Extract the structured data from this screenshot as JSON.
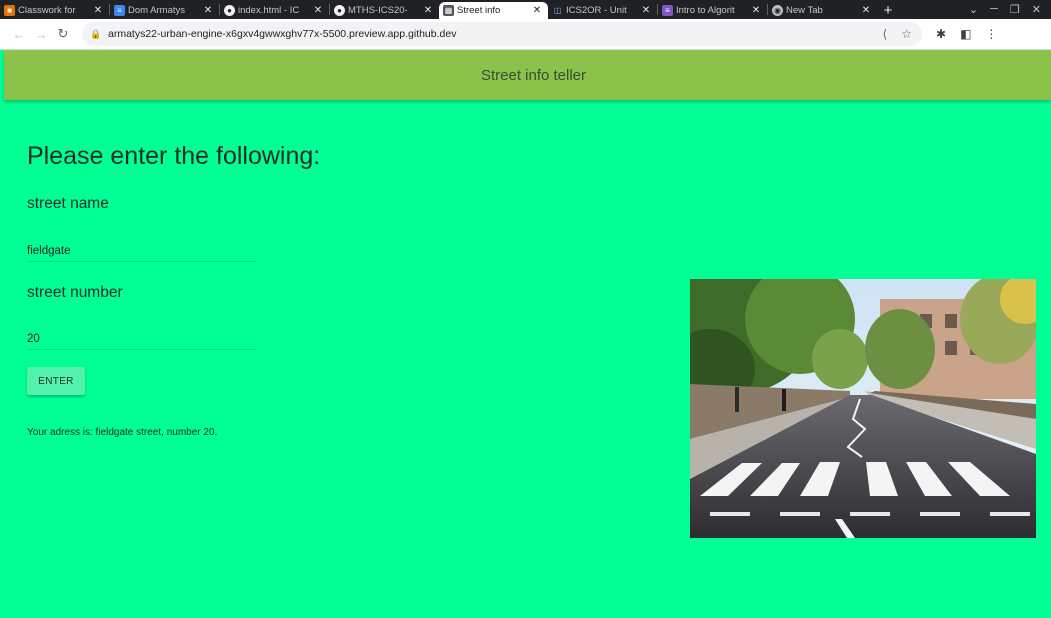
{
  "browser": {
    "tabs": [
      {
        "title": "Classwork for",
        "icon": "classroom-icon",
        "color": "#e37400"
      },
      {
        "title": "Dom Armatys",
        "icon": "docs-icon",
        "color": "#4285f4"
      },
      {
        "title": "index.html - IC",
        "icon": "github-icon",
        "color": "#f0f0f0"
      },
      {
        "title": "MTHS-ICS20-",
        "icon": "github-icon",
        "color": "#f0f0f0"
      },
      {
        "title": "Street info",
        "icon": "page-icon",
        "color": "#555555"
      },
      {
        "title": "ICS2OR - Unit",
        "icon": "trash-icon",
        "color": "#8ab4f8"
      },
      {
        "title": "Intro to Algorit",
        "icon": "list-icon",
        "color": "#7e57c2"
      },
      {
        "title": "New Tab",
        "icon": "chrome-icon",
        "color": "#bdc1c6"
      }
    ],
    "url": "armatys22-urban-engine-x6gxv4gwwxghv77x-5500.preview.app.github.dev"
  },
  "app": {
    "title": "Street info teller",
    "heading": "Please enter the following:",
    "street_name_label": "street name",
    "street_name_value": "fieldgate",
    "street_number_label": "street number",
    "street_number_value": "20",
    "enter_label": "ENTER",
    "result_text": "Your adress is: fieldgate street, number 20."
  },
  "colors": {
    "page_background": "#00ff95",
    "appbar": "#8bc34a",
    "button": "#52f2ac"
  }
}
